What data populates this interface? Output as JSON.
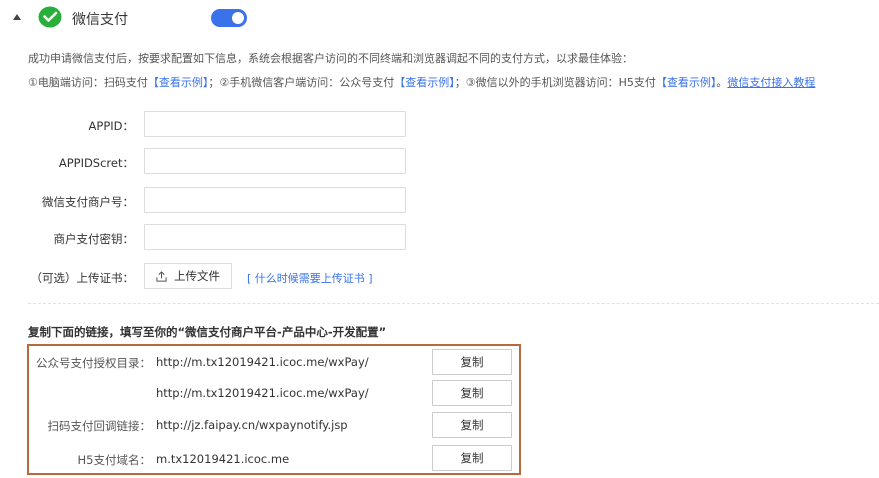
{
  "header": {
    "title": "微信支付",
    "toggle_on": true,
    "accent": "#3a72ea",
    "logo_color": "#2aae3a"
  },
  "description": {
    "line1": "成功申请微信支付后，按要求配置如下信息，系统会根据客户访问的不同终端和浏览器调起不同的支付方式，以求最佳体验：",
    "line2": {
      "p1": "①电脑端访问：扫码支付",
      "l1": "【查看示例】",
      "p2": "；②手机微信客户端访问：公众号支付",
      "l2": "【查看示例】",
      "p3": "；③微信以外的手机浏览器访问：H5支付",
      "l3": "【查看示例】",
      "p4": "。",
      "l4": "微信支付接入教程"
    }
  },
  "form": {
    "appid_label": "APPID：",
    "appid_value": "",
    "secret_label": "APPIDScret：",
    "secret_value": "",
    "merchant_label": "微信支付商户号：",
    "merchant_value": "",
    "key_label": "商户支付密钥：",
    "key_value": "",
    "cert_label": "（可选）上传证书：",
    "upload_label": "上传文件",
    "upload_help": "[ 什么时候需要上传证书 ]"
  },
  "links": {
    "title": "复制下面的链接，填写至你的“微信支付商户平台-产品中心-开发配置”",
    "copy_label": "复制",
    "rows": [
      {
        "label": "公众号支付授权目录：",
        "url": "http://m.tx12019421.icoc.me/wxPay/"
      },
      {
        "label": "",
        "url": "http://m.tx12019421.icoc.me/wxPay/"
      },
      {
        "label": "扫码支付回调链接：",
        "url": "http://jz.faipay.cn/wxpaynotify.jsp"
      },
      {
        "label": "H5支付域名：",
        "url": "m.tx12019421.icoc.me"
      }
    ],
    "border_color": "#b8693e"
  }
}
